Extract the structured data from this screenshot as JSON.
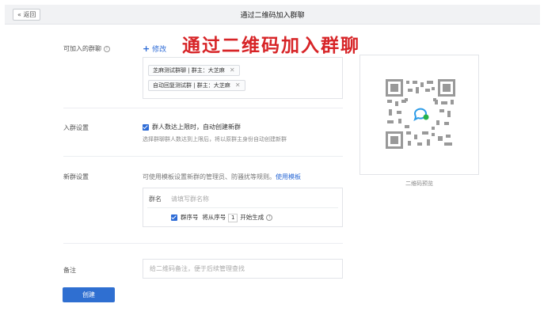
{
  "header": {
    "back_label": "« 返回",
    "title": "通过二维码加入群聊"
  },
  "overlay_title": "通过二维码加入群聊",
  "groups_section": {
    "label": "可加入的群聊",
    "edit_label": "修改",
    "groups": [
      "芝麻测试群聊 | 群主：大芝麻",
      "自动回复测试群 | 群主：大芝麻"
    ]
  },
  "join_settings": {
    "label": "入群设置",
    "auto_create_label": "群人数达上限时，自动创建新群",
    "auto_create_checked": true,
    "hint": "选择群聊群人数达到上限后，将以原群主身份自动创建新群"
  },
  "new_group_settings": {
    "label": "新群设置",
    "hint": "可使用模板设置新群的管理员、防骚扰等规则。",
    "template_link": "使用模板",
    "name_label": "群名",
    "name_placeholder": "请填写群名称",
    "serial_label": "群序号",
    "serial_checked": true,
    "serial_prefix": "将从序号",
    "serial_start": "1",
    "serial_suffix": "开始生成"
  },
  "remark": {
    "label": "备注",
    "placeholder": "给二维码备注，便于后续管理查找"
  },
  "create_button": "创建",
  "qr_preview": {
    "caption": "二维码预览"
  },
  "colors": {
    "accent": "#2d6bd6",
    "overlay_red": "#d72427"
  }
}
